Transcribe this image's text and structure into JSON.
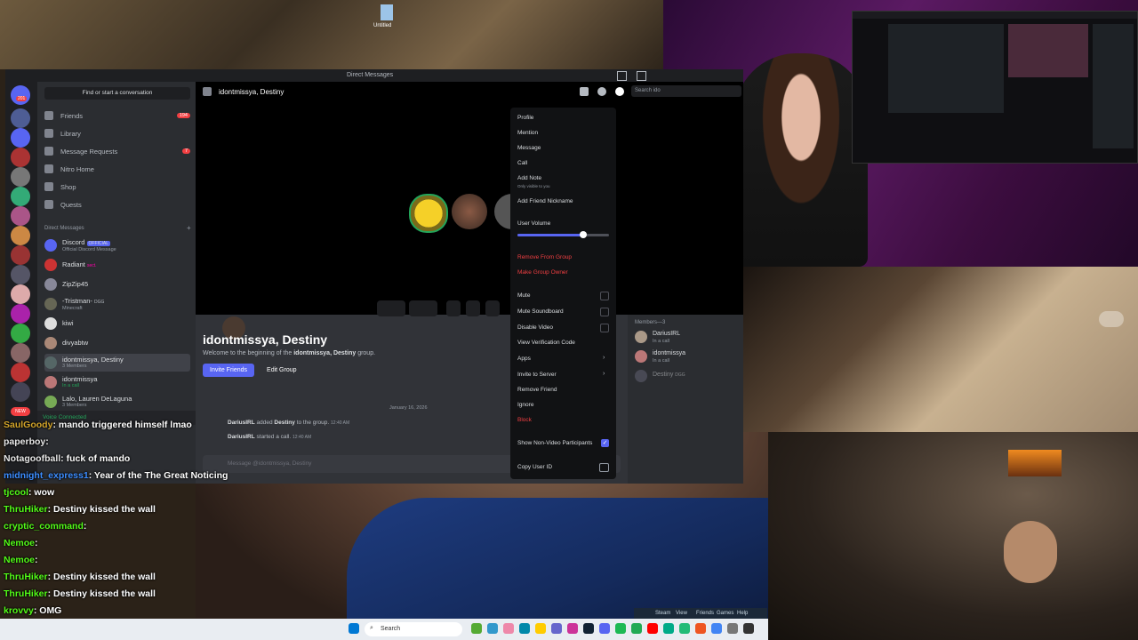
{
  "desktop": {
    "icon_label": "Untitled"
  },
  "discord": {
    "window_title": "Direct Messages",
    "search_placeholder": "Find or start a conversation",
    "nav": [
      {
        "label": "Friends",
        "badge": "194"
      },
      {
        "label": "Library"
      },
      {
        "label": "Message Requests",
        "badge": "7"
      },
      {
        "label": "Nitro Home"
      },
      {
        "label": "Shop"
      },
      {
        "label": "Quests"
      }
    ],
    "dm_header": "Direct Messages",
    "dms": [
      {
        "name": "Discord",
        "tag": "OFFICIAL",
        "sub": "Official Discord Message"
      },
      {
        "name": "Radiant",
        "tag": "sect.",
        "sub": ""
      },
      {
        "name": "ZipZip45",
        "sub": ""
      },
      {
        "name": "-Tristman-",
        "tag": "DGG",
        "sub": "Minecraft"
      },
      {
        "name": "kiwi",
        "sub": ""
      },
      {
        "name": "divyabtw",
        "sub": ""
      },
      {
        "name": "idontmissya, Destiny",
        "sub": "3 Members"
      },
      {
        "name": "idontmissya",
        "sub": "In a call"
      },
      {
        "name": "Lalo, Lauren DeLaguna",
        "sub": "3 Members"
      }
    ],
    "voice_connected": "Voice Connected",
    "server_badge_top": "201",
    "server_new": "NEW",
    "chat_header": "idontmissya, Destiny",
    "header_search": "Search ido",
    "intro_title": "idontmissya, Destiny",
    "intro_text_pre": "Welcome to the beginning of the ",
    "intro_text_group": "idontmissya, Destiny",
    "intro_text_post": " group.",
    "invite_button": "Invite Friends",
    "edit_button": "Edit Group",
    "date_divider": "January 16, 2026",
    "messages": [
      {
        "actor": "DariusIRL",
        "action": "added",
        "target": "Destiny",
        "suffix": "to the group.",
        "time": "12:40 AM"
      },
      {
        "actor": "DariusIRL",
        "action": "started a call.",
        "time": "12:40 AM"
      }
    ],
    "composer_placeholder": "Message @idontmissya, Destiny",
    "members_header": "Members—3",
    "members": [
      {
        "name": "DariusIRL",
        "status": "In a call"
      },
      {
        "name": "idontmissya",
        "status": "In a call"
      },
      {
        "name": "Destiny",
        "tag": "DGG"
      }
    ],
    "context_menu": {
      "items_top": [
        "Profile",
        "Mention",
        "Message",
        "Call"
      ],
      "add_note": "Add Note",
      "add_note_sub": "Only visible to you",
      "add_friend_nickname": "Add Friend Nickname",
      "user_volume": "User Volume",
      "user_volume_level": 0.72,
      "remove_from_group": "Remove From Group",
      "make_group_owner": "Make Group Owner",
      "mute": "Mute",
      "mute_soundboard": "Mute Soundboard",
      "disable_video": "Disable Video",
      "view_verification_code": "View Verification Code",
      "apps": "Apps",
      "invite_to_server": "Invite to Server",
      "remove_friend": "Remove Friend",
      "ignore": "Ignore",
      "block": "Block",
      "show_non_video": "Show Non-Video Participants",
      "copy_user_id": "Copy User ID"
    }
  },
  "chat": [
    {
      "user": "SaulGoody",
      "color": "#d4a52a",
      "msg": ": mando triggered himself lmao"
    },
    {
      "user": "paperboy",
      "color": "#e8e8e8",
      "msg": ":"
    },
    {
      "user": "Notagoofball",
      "color": "#e8e8e8",
      "msg": ": fuck of mando"
    },
    {
      "user": "midnight_express1",
      "color": "#3c8dff",
      "msg": ": Year of the The Great Noticing"
    },
    {
      "user": "tjcool",
      "color": "#53fc18",
      "msg": ": ",
      "extra": "wow"
    },
    {
      "user": "ThruHiker",
      "color": "#53fc18",
      "msg": ": Destiny kissed the wall"
    },
    {
      "user": "cryptic_command",
      "color": "#53fc18",
      "msg": ":"
    },
    {
      "user": "Nemoe",
      "color": "#53fc18",
      "msg": ":"
    },
    {
      "user": "Nemoe",
      "color": "#53fc18",
      "msg": ":"
    },
    {
      "user": "ThruHiker",
      "color": "#53fc18",
      "msg": ": Destiny kissed the wall"
    },
    {
      "user": "ThruHiker",
      "color": "#53fc18",
      "msg": ": Destiny kissed the wall"
    },
    {
      "user": "krovvy",
      "color": "#53fc18",
      "msg": ": OMG"
    }
  ],
  "taskbar": {
    "search": "Search"
  },
  "steam": {
    "items": [
      "Steam",
      "View",
      "Friends",
      "Games",
      "Help"
    ]
  }
}
